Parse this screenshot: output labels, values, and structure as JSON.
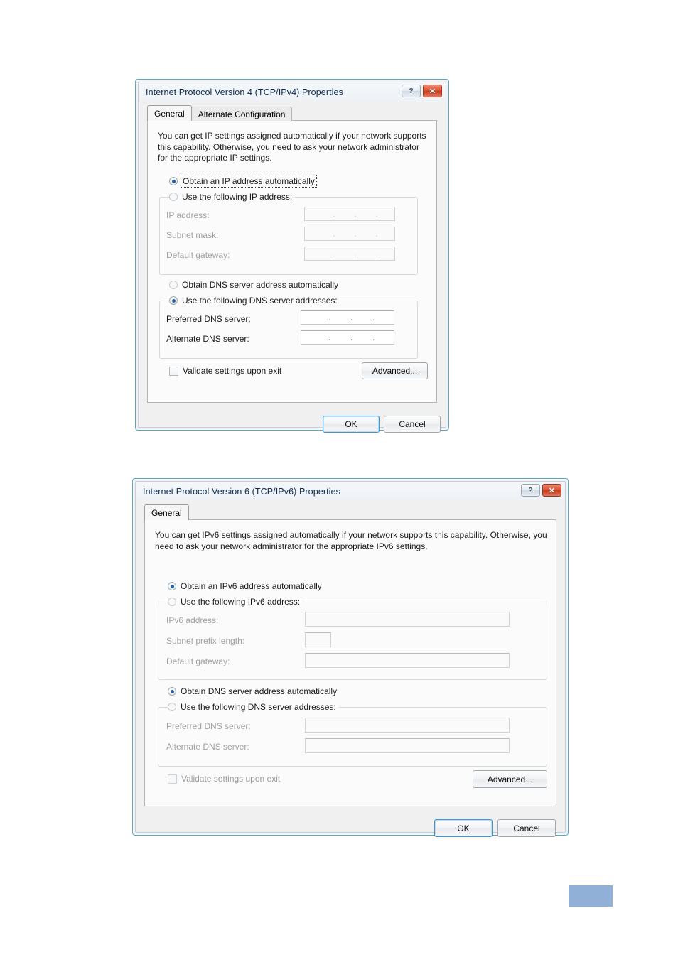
{
  "ipv4_dialog": {
    "title": "Internet Protocol Version 4 (TCP/IPv4) Properties",
    "help_button": "?",
    "close_button": "✕",
    "tabs": [
      {
        "label": "General",
        "active": true
      },
      {
        "label": "Alternate Configuration",
        "active": false
      }
    ],
    "intro": "You can get IP settings assigned automatically if your network supports this capability. Otherwise, you need to ask your network administrator for the appropriate IP settings.",
    "ip_mode": {
      "auto_label": "Obtain an IP address automatically",
      "manual_label": "Use the following IP address:",
      "selected": "auto"
    },
    "ip_fields": [
      {
        "label": "IP address:",
        "value": "",
        "enabled": false
      },
      {
        "label": "Subnet mask:",
        "value": "",
        "enabled": false
      },
      {
        "label": "Default gateway:",
        "value": "",
        "enabled": false
      }
    ],
    "dns_mode": {
      "auto_label": "Obtain DNS server address automatically",
      "manual_label": "Use the following DNS server addresses:",
      "selected": "manual"
    },
    "dns_fields": [
      {
        "label": "Preferred DNS server:",
        "value": "",
        "enabled": true
      },
      {
        "label": "Alternate DNS server:",
        "value": "",
        "enabled": true
      }
    ],
    "validate_checkbox": {
      "label": "Validate settings upon exit",
      "checked": false,
      "enabled": true
    },
    "advanced_button": "Advanced...",
    "ok_button": "OK",
    "cancel_button": "Cancel"
  },
  "ipv6_dialog": {
    "title": "Internet Protocol Version 6 (TCP/IPv6) Properties",
    "help_button": "?",
    "close_button": "✕",
    "tabs": [
      {
        "label": "General",
        "active": true
      }
    ],
    "intro": "You can get IPv6 settings assigned automatically if your network supports this capability. Otherwise, you need to ask your network administrator for the appropriate IPv6 settings.",
    "ip_mode": {
      "auto_label": "Obtain an IPv6 address automatically",
      "manual_label": "Use the following IPv6 address:",
      "selected": "auto"
    },
    "ip_fields": [
      {
        "label": "IPv6 address:",
        "value": "",
        "enabled": false
      },
      {
        "label": "Subnet prefix length:",
        "value": "",
        "enabled": false
      },
      {
        "label": "Default gateway:",
        "value": "",
        "enabled": false
      }
    ],
    "dns_mode": {
      "auto_label": "Obtain DNS server address automatically",
      "manual_label": "Use the following DNS server addresses:",
      "selected": "auto"
    },
    "dns_fields": [
      {
        "label": "Preferred DNS server:",
        "value": "",
        "enabled": false
      },
      {
        "label": "Alternate DNS server:",
        "value": "",
        "enabled": false
      }
    ],
    "validate_checkbox": {
      "label": "Validate settings upon exit",
      "checked": false,
      "enabled": false
    },
    "advanced_button": "Advanced...",
    "ok_button": "OK",
    "cancel_button": "Cancel"
  },
  "page_marker": {
    "color": "#91b0d8"
  },
  "colors": {
    "window_border": "#5ca8c4",
    "title_text": "#0c2c53",
    "accent_blue": "#1f5fa8",
    "close_red": "#c53c20",
    "disabled_text": "#9a9a9a"
  }
}
